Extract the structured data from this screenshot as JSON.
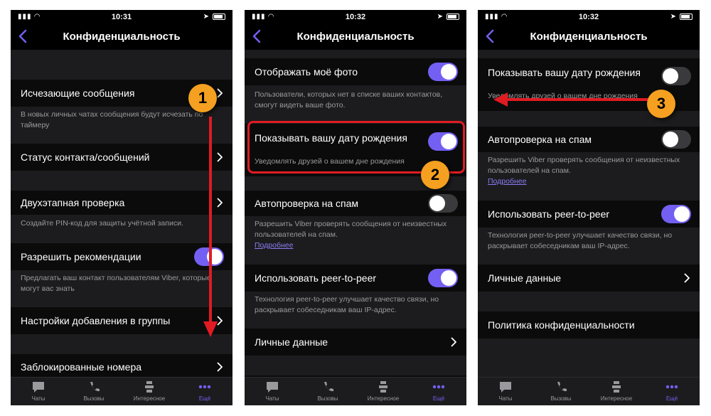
{
  "phones": [
    {
      "time": "10:31",
      "title": "Конфиденциальность",
      "rows": {
        "disappearing": "Исчезающие сообщения",
        "disappearing_desc": "В новых личных чатах сообщения будут исчезать по таймеру",
        "status": "Статус контакта/сообщений",
        "twostep": "Двухэтапная проверка",
        "twostep_desc": "Создайте PIN-код для защиты учётной записи.",
        "recommend": "Разрешить рекомендации",
        "recommend_desc": "Предлагать ваш контакт пользователям Viber, которые могут вас знать",
        "groups": "Настройки добавления в группы",
        "blocked": "Заблокированные номера"
      },
      "badge": "1"
    },
    {
      "time": "10:32",
      "title": "Конфиденциальность",
      "rows": {
        "photo": "Отображать моё фото",
        "photo_desc": "Пользователи, которых нет в списке ваших контактов, смогут видеть ваше фото.",
        "birthday": "Показывать вашу дату рождения",
        "birthday_desc": "Уведомлять друзей о вашем дне рождения",
        "spam": "Автопроверка на спам",
        "spam_desc": "Разрешить Viber проверять сообщения от неизвестных пользователей на спам.",
        "more": "Подробнее",
        "p2p": "Использовать peer-to-peer",
        "p2p_desc": "Технология peer-to-peer улучшает качество связи, но раскрывает собеседникам ваш IP-адрес.",
        "personal": "Личные данные"
      },
      "badge": "2"
    },
    {
      "time": "10:32",
      "title": "Конфиденциальность",
      "rows": {
        "birthday": "Показывать вашу дату рождения",
        "birthday_desc": "Уведомлять друзей о вашем дне рождения",
        "spam": "Автопроверка на спам",
        "spam_desc": "Разрешить Viber проверять сообщения от неизвестных пользователей на спам.",
        "more": "Подробнее",
        "p2p": "Использовать peer-to-peer",
        "p2p_desc": "Технология peer-to-peer улучшает качество связи, но раскрывает собеседникам ваш IP-адрес.",
        "personal": "Личные данные",
        "policy": "Политика конфиденциальности"
      },
      "badge": "3"
    }
  ],
  "tabs": {
    "chats": "Чаты",
    "calls": "Вызовы",
    "explore": "Интересное",
    "more": "Ещё"
  },
  "colors": {
    "accent": "#7360f2",
    "highlight": "#e11b22",
    "badge": "#f5a020"
  }
}
